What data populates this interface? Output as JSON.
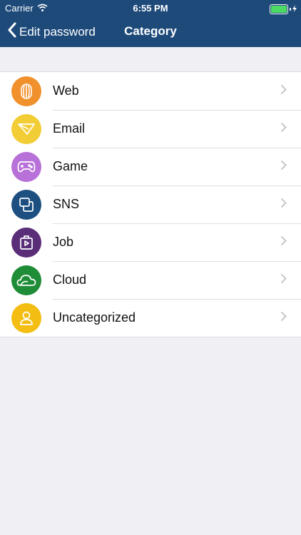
{
  "status_bar": {
    "carrier": "Carrier",
    "time": "6:55 PM"
  },
  "nav": {
    "back_label": "Edit password",
    "title": "Category"
  },
  "categories": [
    {
      "label": "Web",
      "icon": "globe-icon",
      "color": "#f0912e"
    },
    {
      "label": "Email",
      "icon": "email-icon",
      "color": "#f2cd36"
    },
    {
      "label": "Game",
      "icon": "gamepad-icon",
      "color": "#b771d9"
    },
    {
      "label": "SNS",
      "icon": "sns-icon",
      "color": "#1d4f80"
    },
    {
      "label": "Job",
      "icon": "briefcase-icon",
      "color": "#5a2d78"
    },
    {
      "label": "Cloud",
      "icon": "cloud-icon",
      "color": "#1f8c37"
    },
    {
      "label": "Uncategorized",
      "icon": "person-icon",
      "color": "#f3bd12"
    }
  ],
  "colors": {
    "nav_bar": "#1e4a7a",
    "background": "#efeff4",
    "battery": "#4cd964"
  }
}
